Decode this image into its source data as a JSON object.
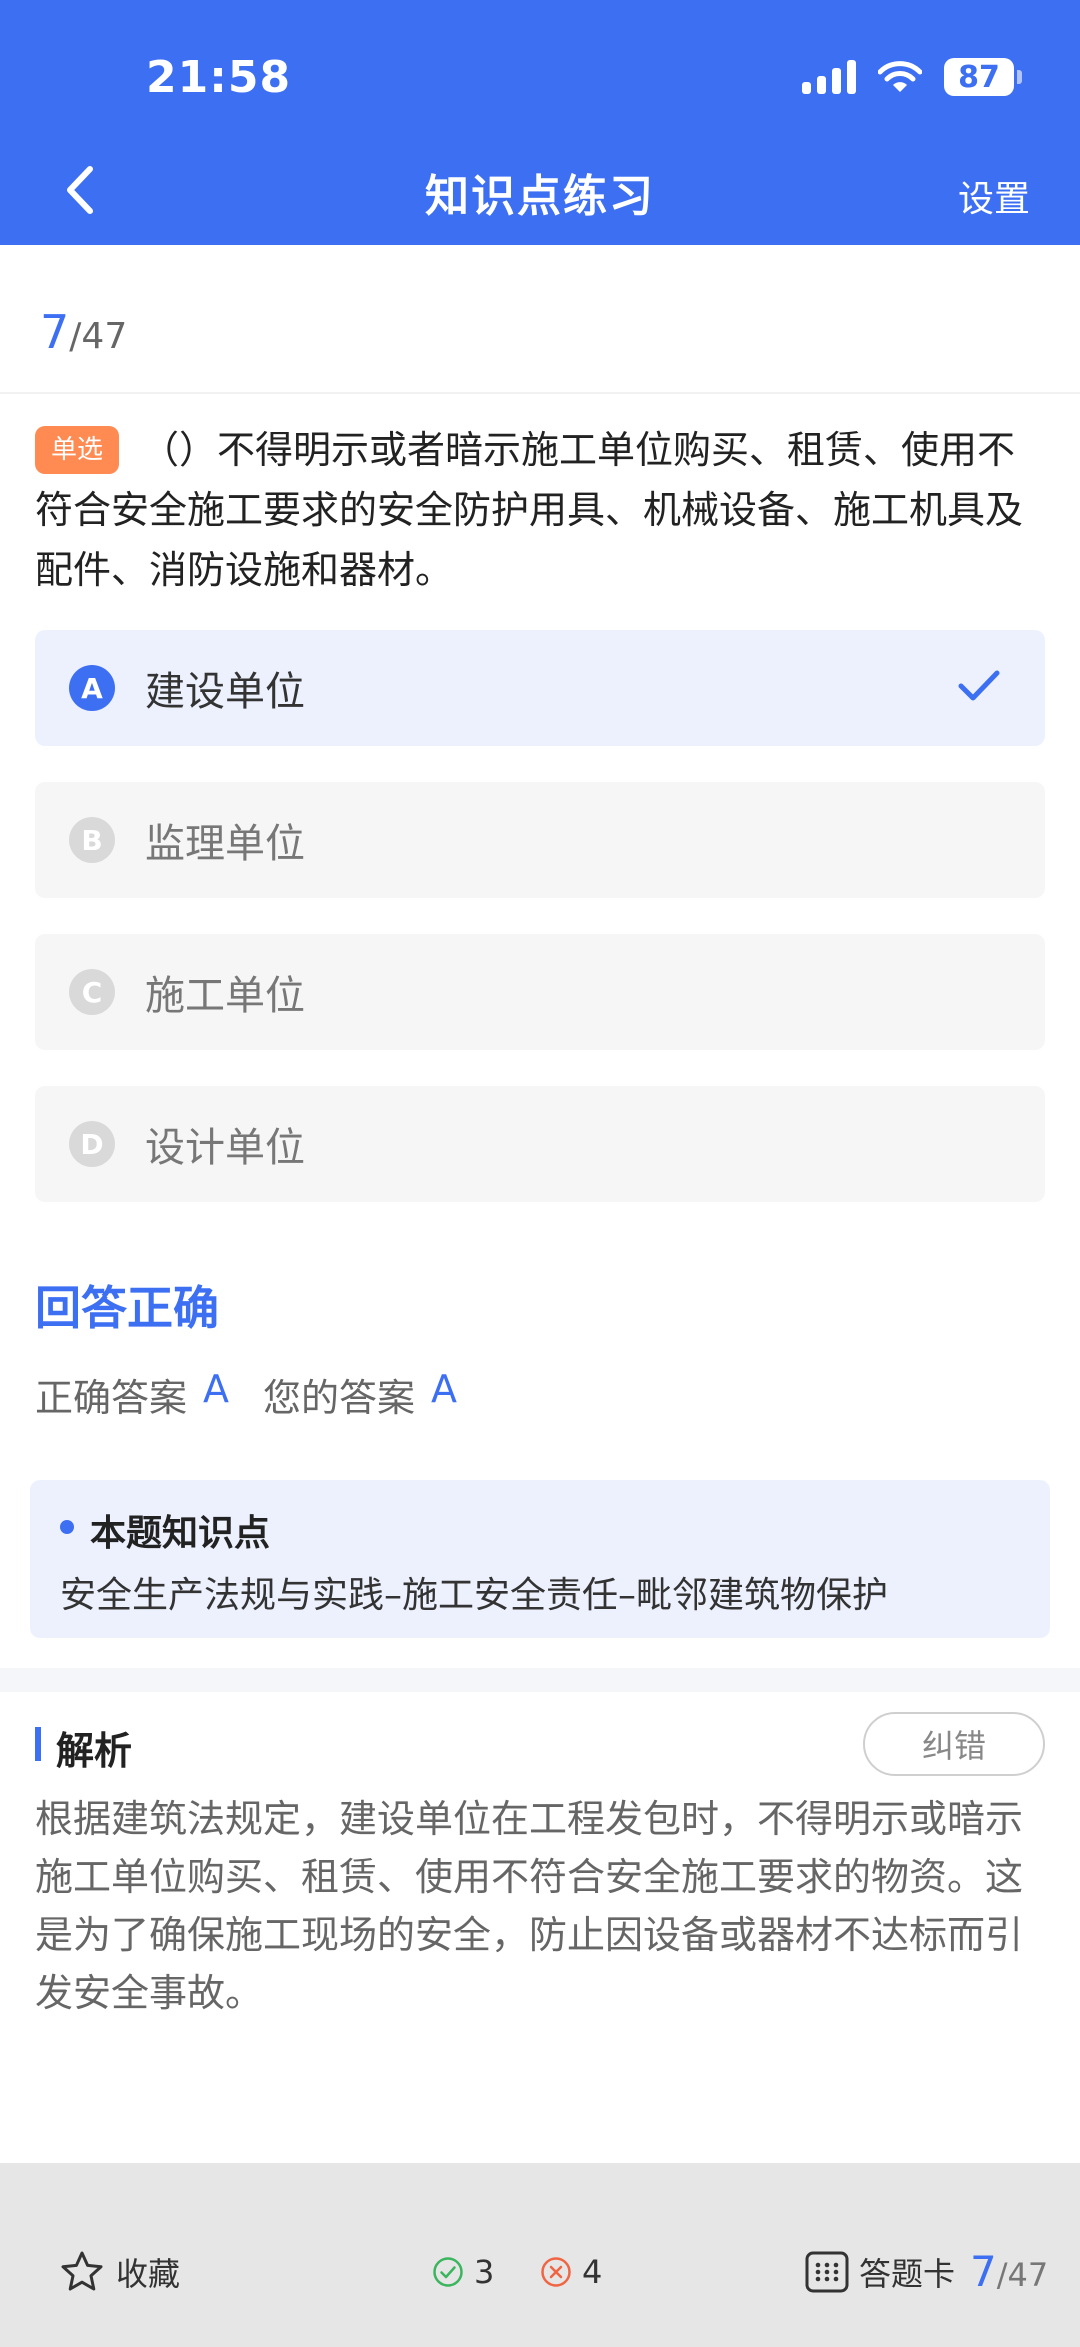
{
  "status_bar": {
    "time": "21:58",
    "battery": "87"
  },
  "nav": {
    "title": "知识点练习",
    "settings": "设置"
  },
  "progress": {
    "current": "7",
    "total": "/47"
  },
  "question": {
    "tag": "单选",
    "text": "（）不得明示或者暗示施工单位购买、租赁、使用不符合安全施工要求的安全防护用具、机械设备、施工机具及配件、消防设施和器材。"
  },
  "options": [
    {
      "letter": "A",
      "text": "建设单位",
      "selected": true
    },
    {
      "letter": "B",
      "text": "监理单位",
      "selected": false
    },
    {
      "letter": "C",
      "text": "施工单位",
      "selected": false
    },
    {
      "letter": "D",
      "text": "设计单位",
      "selected": false
    }
  ],
  "result": {
    "title": "回答正确",
    "correct_label": "正确答案",
    "correct_value": "A",
    "your_label": "您的答案",
    "your_value": "A"
  },
  "knowledge_point": {
    "title": "本题知识点",
    "text": "安全生产法规与实践–施工安全责任–毗邻建筑物保护"
  },
  "analysis": {
    "title": "解析",
    "report_button": "纠错",
    "text": "根据建筑法规定，建设单位在工程发包时，不得明示或暗示施工单位购买、租赁、使用不符合安全施工要求的物资。这是为了确保施工现场的安全，防止因设备或器材不达标而引发安全事故。"
  },
  "bottom_bar": {
    "favorite": "收藏",
    "correct_count": "3",
    "wrong_count": "4",
    "answer_card": "答题卡",
    "progress_current": "7",
    "progress_total": "/47"
  },
  "colors": {
    "primary": "#3d6ff3",
    "tag": "#ff8a52",
    "correct": "#3bb55e",
    "wrong": "#f06543"
  }
}
